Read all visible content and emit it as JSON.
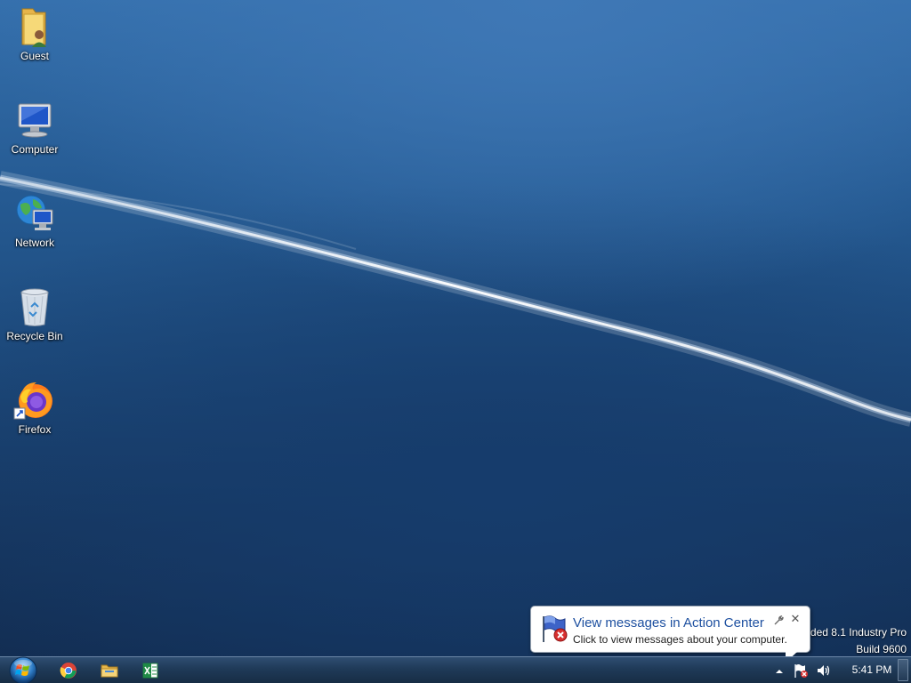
{
  "desktop": {
    "icons": [
      {
        "label": "Guest",
        "icon": "user-folder-icon"
      },
      {
        "label": "Computer",
        "icon": "computer-icon"
      },
      {
        "label": "Network",
        "icon": "network-icon"
      },
      {
        "label": "Recycle Bin",
        "icon": "recycle-bin-icon"
      },
      {
        "label": "Firefox",
        "icon": "firefox-icon",
        "shortcut": true
      }
    ],
    "watermark": {
      "line1": "lded 8.1 Industry Pro",
      "line2": "Build 9600"
    }
  },
  "notification": {
    "title": "View messages in Action Center",
    "text": "Click to view messages about your computer.",
    "close_label": "✕",
    "icon": "action-center-flag-icon"
  },
  "taskbar": {
    "start": {
      "icon": "windows-start-orb-icon"
    },
    "pinned": [
      {
        "name": "Google Chrome",
        "icon": "chrome-icon"
      },
      {
        "name": "File Explorer",
        "icon": "file-explorer-icon"
      },
      {
        "name": "Excel",
        "icon": "excel-icon"
      }
    ],
    "tray": {
      "show_hidden": "show-hidden-icons-icon",
      "action_center": "action-center-flag-icon",
      "volume": "volume-icon",
      "clock": "5:41 PM"
    }
  },
  "colors": {
    "taskbar": "#1f3a58",
    "balloon_title": "#1e50a0",
    "desktop_top": "#3570ad",
    "desktop_bottom": "#122c50"
  }
}
